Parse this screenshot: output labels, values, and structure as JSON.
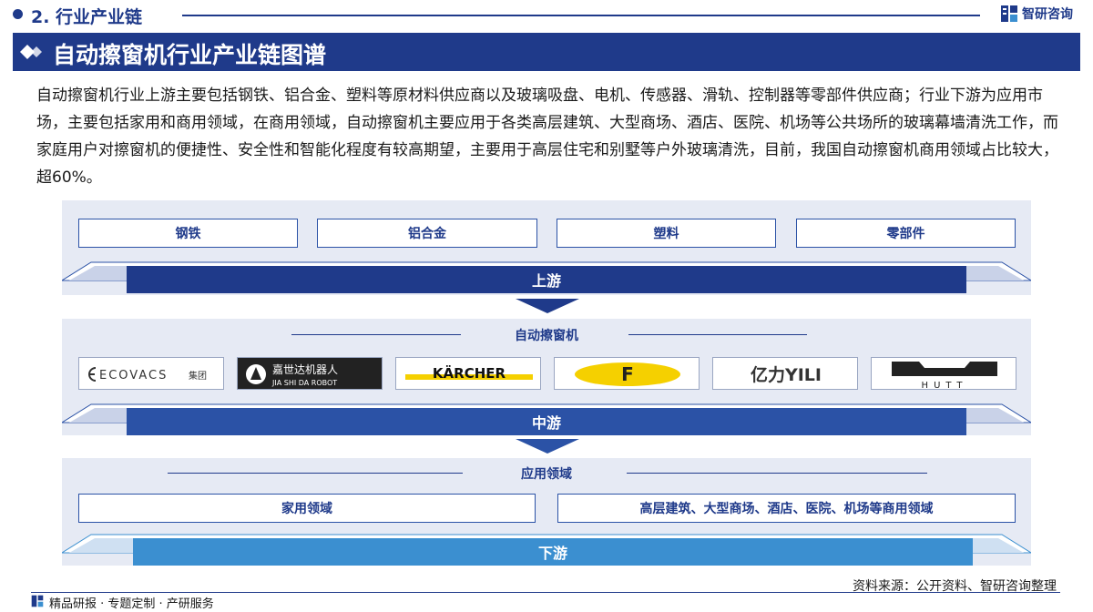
{
  "header": {
    "section_title": "2. 行业产业链",
    "brand_name": "智研咨询"
  },
  "banner": {
    "title": "自动擦窗机行业产业链图谱"
  },
  "description": "自动擦窗机行业上游主要包括钢铁、铝合金、塑料等原材料供应商以及玻璃吸盘、电机、传感器、滑轨、控制器等零部件供应商；行业下游为应用市场，主要包括家用和商用领域，在商用领域，自动擦窗机主要应用于各类高层建筑、大型商场、酒店、医院、机场等公共场所的玻璃幕墙清洗工作，而家庭用户对擦窗机的便捷性、安全性和智能化程度有较高期望，主要用于高层住宅和别墅等户外玻璃清洗，目前，我国自动擦窗机商用领域占比较大，超60%。",
  "upstream": {
    "items": [
      "钢铁",
      "铝合金",
      "塑料",
      "零部件"
    ],
    "label": "上游"
  },
  "midstream": {
    "heading": "自动擦窗机",
    "label": "中游",
    "logos": [
      {
        "icon": "ecovacs-logo",
        "text": "ECOVACS",
        "suffix": "集团"
      },
      {
        "icon": "jiashida-logo",
        "text_cn": "嘉世达机器人",
        "text_en": "JIA SHI DA ROBOT"
      },
      {
        "icon": "karcher-logo",
        "text": "KÄRCHER"
      },
      {
        "icon": "f-logo",
        "text": "F"
      },
      {
        "icon": "yili-logo",
        "text": "亿力YILI"
      },
      {
        "icon": "hutt-logo",
        "text": "HUTT"
      }
    ]
  },
  "downstream": {
    "heading": "应用领域",
    "items": [
      "家用领域",
      "高层建筑、大型商场、酒店、医院、机场等商用领域"
    ],
    "label": "下游"
  },
  "footer": {
    "slogan": "精品研报 · 专题定制 · 产研服务",
    "source": "资料来源：公开资料、智研咨询整理"
  },
  "colors": {
    "navy": "#1f3a8a",
    "blue": "#2b52a6",
    "light_blue": "#3b8fd0",
    "panel": "#e6eaf4"
  }
}
